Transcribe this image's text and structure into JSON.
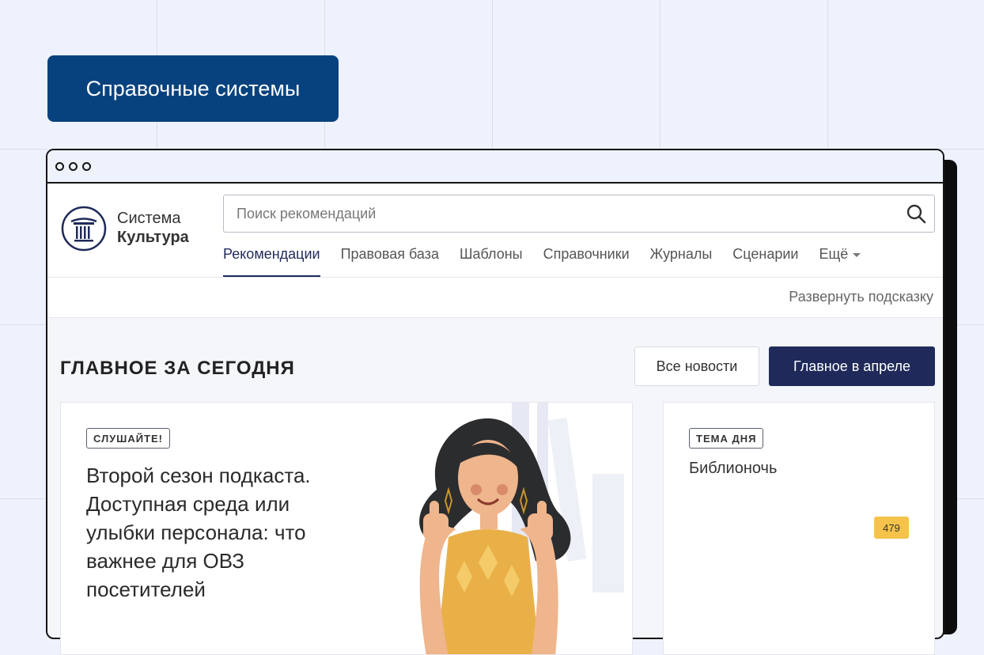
{
  "promo": {
    "label": "Справочные системы"
  },
  "site": {
    "brand_line1": "Система",
    "brand_line2": "Культура"
  },
  "search": {
    "placeholder": "Поиск рекомендаций"
  },
  "nav": {
    "items": [
      {
        "label": "Рекомендации",
        "active": true
      },
      {
        "label": "Правовая база"
      },
      {
        "label": "Шаблоны"
      },
      {
        "label": "Справочники"
      },
      {
        "label": "Журналы"
      },
      {
        "label": "Сценарии"
      },
      {
        "label": "Ещё",
        "dropdown": true
      }
    ]
  },
  "subbar": {
    "expand_hint": "Развернуть подсказку"
  },
  "section": {
    "title": "ГЛАВНОЕ ЗА СЕГОДНЯ",
    "all_news": "Все новости",
    "april": "Главное в апреле"
  },
  "main_card": {
    "badge": "СЛУШАЙТЕ!",
    "headline": "Второй сезон подкаста. Доступная среда или улыбки персонала: что важнее для ОВЗ посетителей"
  },
  "side_card": {
    "badge": "ТЕМА ДНЯ",
    "title": "Библионочь",
    "count": "479"
  },
  "colors": {
    "accent": "#1f2a5a",
    "promo": "#08427e",
    "badge_count": "#f6c34a"
  },
  "icons": [
    "logo-column-icon",
    "search-icon",
    "chevron-down-icon"
  ]
}
